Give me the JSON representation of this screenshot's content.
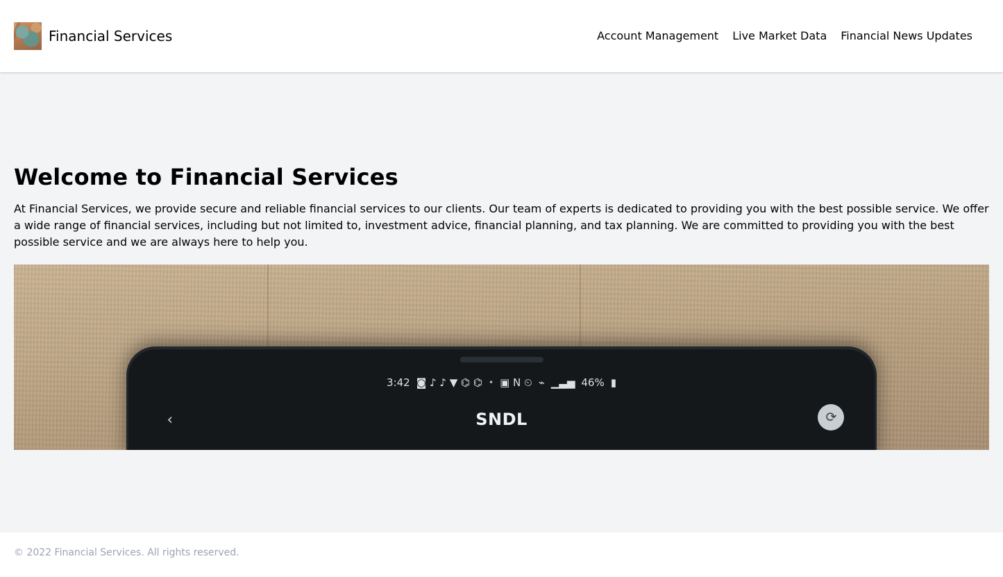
{
  "header": {
    "brand_name": "Financial Services",
    "logo_icon": "brand-logo-image",
    "nav": [
      {
        "label": "Account Management"
      },
      {
        "label": "Live Market Data"
      },
      {
        "label": "Financial News Updates"
      }
    ]
  },
  "main": {
    "heading": "Welcome to Financial Services",
    "paragraph": "At Financial Services, we provide secure and reliable financial services to our clients. Our team of experts is dedicated to providing you with the best possible service. We offer a wide range of financial services, including but not limited to, investment advice, financial planning, and tax planning. We are committed to providing you with the best possible service and we are always here to help you.",
    "hero": {
      "alt": "smartphone-on-cardboard-photo",
      "status_time": "3:42",
      "status_icons_left": "◙ ♪ ♪ ▼ ⌬ ⌬",
      "status_dot": "•",
      "status_icons_right": "▣ N ⏲ ",
      "battery_percent": "46%",
      "app_label": "SNDL"
    }
  },
  "footer": {
    "copyright": "© 2022 Financial Services. All rights reserved."
  },
  "colors": {
    "page_bg": "#f3f4f6",
    "surface": "#ffffff",
    "text": "#000000",
    "muted": "#9ca3af"
  }
}
